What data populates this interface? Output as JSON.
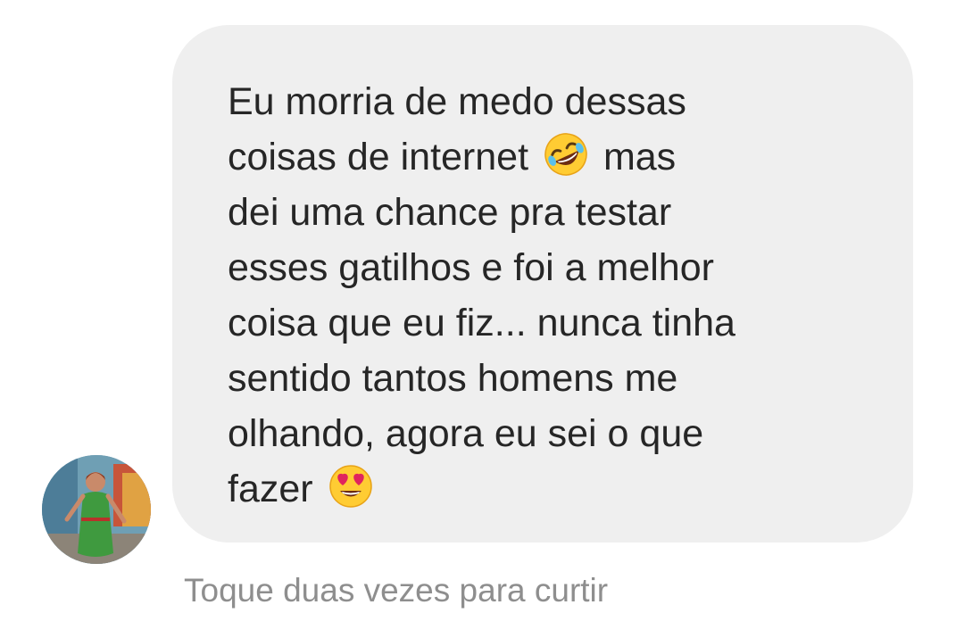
{
  "message": {
    "lines": [
      {
        "text": "Eu morria de medo dessas"
      },
      {
        "before": "coisas de internet",
        "emoji": "rolling-on-floor-laughing-emoji",
        "after": "mas"
      },
      {
        "text": "dei uma chance pra testar"
      },
      {
        "text": "esses gatilhos e foi a melhor"
      },
      {
        "text": "coisa que eu fiz... nunca tinha"
      },
      {
        "text": "sentido tantos homens me"
      },
      {
        "text": "olhando, agora eu sei o que"
      },
      {
        "before": "fazer",
        "emoji": "smiling-face-with-heart-eyes-emoji"
      }
    ]
  },
  "sender": {
    "avatar_icon": "profile-avatar"
  },
  "hint": {
    "label": "Toque duas vezes para curtir"
  },
  "colors": {
    "bubble": "#efefef",
    "text": "#262626",
    "hint": "#8e8e8e",
    "background": "#ffffff"
  }
}
